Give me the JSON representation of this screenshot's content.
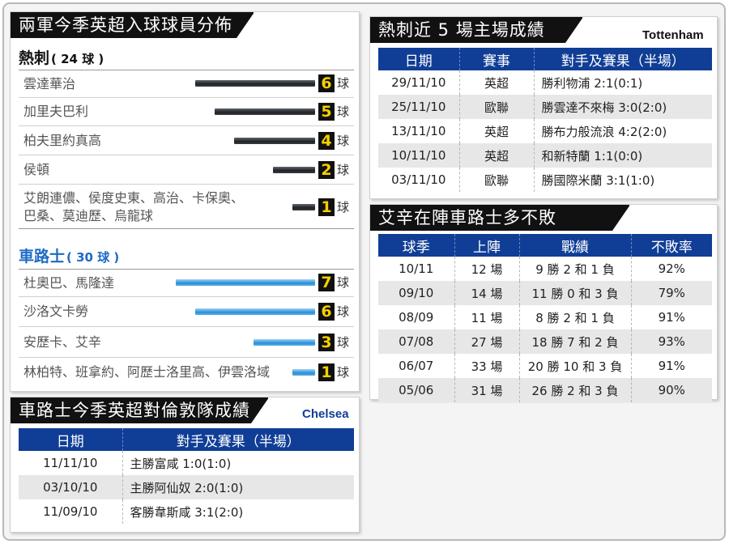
{
  "scorers": {
    "title": "兩軍今季英超入球球員分佈",
    "unit": "球",
    "spurs": {
      "name": "熱刺",
      "count": "( 24 球 )",
      "players": [
        {
          "name": "雲達華治",
          "goals": 6
        },
        {
          "name": "加里夫巴利",
          "goals": 5
        },
        {
          "name": "柏夫里約真高",
          "goals": 4
        },
        {
          "name": "侯頓",
          "goals": 2
        },
        {
          "name_line1": "艾朗連儂、侯度史東、高治、卡保奧、",
          "name_line2": "巴桑、莫迪歷、烏龍球",
          "goals": 1
        }
      ]
    },
    "chelsea": {
      "name": "車路士",
      "count": "( 30 球 )",
      "players": [
        {
          "name": "杜奧巴、馬隆達",
          "goals": 7
        },
        {
          "name": "沙洛文卡勞",
          "goals": 6
        },
        {
          "name": "安歷卡、艾辛",
          "goals": 3
        },
        {
          "name": "林柏特、班拿約、阿歷士洛里高、伊雲洛域",
          "goals": 1
        }
      ]
    }
  },
  "chelsea_vs_london": {
    "title": "車路士今季英超對倫敦隊成績",
    "team_en": "Chelsea",
    "headers": [
      "日期",
      "對手及賽果（半場）"
    ],
    "rows": [
      [
        "11/11/10",
        "主勝富咸 1:0(1:0)"
      ],
      [
        "03/10/10",
        "主勝阿仙奴 2:0(1:0)"
      ],
      [
        "11/09/10",
        "客勝韋斯咸 3:1(2:0)"
      ]
    ]
  },
  "spurs_home": {
    "title": "熱刺近 5 場主場成績",
    "team_en": "Tottenham",
    "headers": [
      "日期",
      "賽事",
      "對手及賽果（半場）"
    ],
    "rows": [
      [
        "29/11/10",
        "英超",
        "勝利物浦 2:1(0:1)"
      ],
      [
        "25/11/10",
        "歐聯",
        "勝雲達不來梅 3:0(2:0)"
      ],
      [
        "13/11/10",
        "英超",
        "勝布力般流浪 4:2(2:0)"
      ],
      [
        "10/11/10",
        "英超",
        "和新特蘭 1:1(0:0)"
      ],
      [
        "03/11/10",
        "歐聯",
        "勝國際米蘭 3:1(1:0)"
      ]
    ]
  },
  "essien": {
    "title": "艾辛在陣車路士多不敗",
    "headers": [
      "球季",
      "上陣",
      "戰績",
      "不敗率"
    ],
    "rows": [
      [
        "10/11",
        "12 場",
        "9 勝 2 和 1 負",
        "92%"
      ],
      [
        "09/10",
        "14 場",
        "11 勝 0 和 3 負",
        "79%"
      ],
      [
        "08/09",
        "11 場",
        "8 勝 2 和 1 負",
        "91%"
      ],
      [
        "07/08",
        "27 場",
        "18 勝 7 和 2 負",
        "93%"
      ],
      [
        "06/07",
        "33 場",
        "20 勝 10 和 3 負",
        "91%"
      ],
      [
        "05/06",
        "31 場",
        "26 勝 2 和 3 負",
        "90%"
      ]
    ]
  }
}
